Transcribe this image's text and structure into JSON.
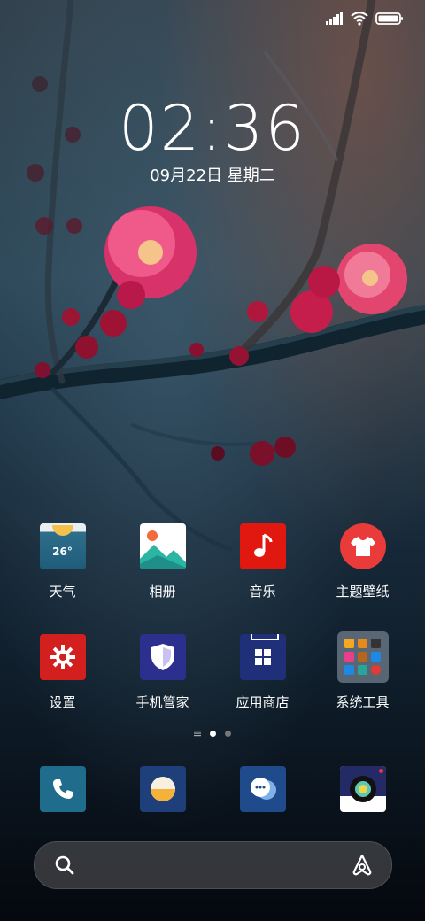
{
  "status_bar": {
    "signal_icon": "signal-icon",
    "wifi_icon": "wifi-icon",
    "battery_icon": "battery-icon"
  },
  "lock": {
    "time": "02:36",
    "date": "09月22日 星期二"
  },
  "apps_row1": [
    {
      "label": "天气",
      "icon": "weather-icon",
      "temp": "26°"
    },
    {
      "label": "相册",
      "icon": "gallery-icon"
    },
    {
      "label": "音乐",
      "icon": "music-icon"
    },
    {
      "label": "主题壁纸",
      "icon": "themes-icon"
    }
  ],
  "apps_row2": [
    {
      "label": "设置",
      "icon": "settings-icon"
    },
    {
      "label": "手机管家",
      "icon": "security-icon"
    },
    {
      "label": "应用商店",
      "icon": "app-store-icon"
    },
    {
      "label": "系统工具",
      "icon": "tools-folder-icon"
    }
  ],
  "page_indicator": {
    "pages": 2,
    "active": 1
  },
  "dock": [
    {
      "icon": "phone-icon"
    },
    {
      "icon": "browser-icon"
    },
    {
      "icon": "messages-icon"
    },
    {
      "icon": "camera-icon"
    }
  ],
  "search_bar": {
    "search_icon": "search-icon",
    "assistant_icon": "assistant-icon"
  },
  "colors": {
    "weather": "#2f6f8f",
    "gallery": "#ffffff",
    "music": "#e0180f",
    "themes": "#e93b39",
    "settings": "#d41f1f",
    "security": "#2d2f8f",
    "store": "#1f2f7a",
    "phone": "#1f6c8c",
    "browser": "#1f3f7a",
    "messages": "#1f4a8c"
  }
}
